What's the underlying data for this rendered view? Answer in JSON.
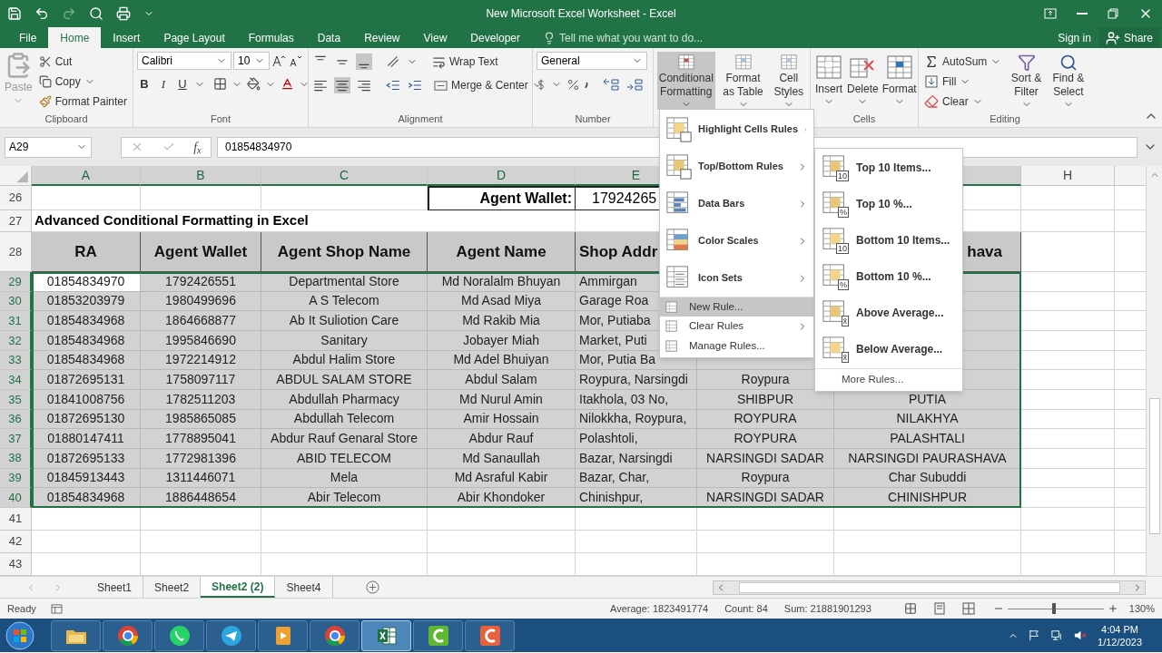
{
  "window": {
    "title": "New Microsoft Excel Worksheet - Excel"
  },
  "tabs": [
    {
      "label": "File",
      "selected": false
    },
    {
      "label": "Home",
      "selected": true
    },
    {
      "label": "Insert",
      "selected": false
    },
    {
      "label": "Page Layout",
      "selected": false
    },
    {
      "label": "Formulas",
      "selected": false
    },
    {
      "label": "Data",
      "selected": false
    },
    {
      "label": "Review",
      "selected": false
    },
    {
      "label": "View",
      "selected": false
    },
    {
      "label": "Developer",
      "selected": false
    }
  ],
  "tell_me": {
    "placeholder": "Tell me what you want to do..."
  },
  "account": {
    "sign_in": "Sign in",
    "share": "Share"
  },
  "ribbon": {
    "clipboard": {
      "label": "Clipboard",
      "paste": "Paste",
      "cut": "Cut",
      "copy": "Copy",
      "format_painter": "Format Painter"
    },
    "font": {
      "label": "Font",
      "name": "Calibri",
      "size": "10",
      "bold": "B",
      "italic": "I",
      "underline": "U"
    },
    "alignment": {
      "label": "Alignment",
      "wrap_text": "Wrap Text",
      "merge": "Merge & Center"
    },
    "number": {
      "label": "Number",
      "format": "General"
    },
    "styles": {
      "conditional_formatting": {
        "label": "Conditional Formatting",
        "expanded": true
      },
      "format_as_table": "Format as Table",
      "cell_styles": "Cell Styles"
    },
    "cells": {
      "label": "Cells",
      "insert": "Insert",
      "delete": "Delete",
      "format": "Format"
    },
    "editing": {
      "label": "Editing",
      "autosum": "AutoSum",
      "fill": "Fill",
      "clear": "Clear",
      "sort_filter": "Sort & Filter",
      "find_select": "Find & Select"
    }
  },
  "formula_bar": {
    "name_box": "A29",
    "function_label": "f$_{x}$",
    "value": "01854834970"
  },
  "grid": {
    "columns": [
      {
        "label": "A",
        "selected": true
      },
      {
        "label": "B",
        "selected": true
      },
      {
        "label": "C",
        "selected": true
      },
      {
        "label": "D",
        "selected": true
      },
      {
        "label": "E",
        "selected": true
      },
      null,
      {
        "selected": true
      },
      {
        "label": "H",
        "selected": false
      }
    ],
    "rows": [
      {
        "number": "26",
        "kind": "wallet",
        "selected": false,
        "cells": [
          null,
          null,
          null,
          "Agent Wallet:",
          "17924265"
        ]
      },
      {
        "number": "27",
        "kind": "title",
        "selected": false,
        "cells": [
          "Advanced Conditional Formatting in Excel"
        ]
      },
      {
        "number": "28",
        "kind": "header",
        "selected": false,
        "cells": [
          "RA",
          "Agent Wallet",
          "Agent Shop Name",
          "Agent Name",
          "Shop Addr",
          null,
          "hava"
        ]
      },
      {
        "number": "29",
        "kind": "data",
        "selected": true,
        "active": true,
        "cells": [
          "01854834970",
          "1792426551",
          "Departmental Store",
          "Md Noralalm Bhuyan",
          "Ammirgan",
          null,
          null
        ]
      },
      {
        "number": "30",
        "kind": "data",
        "selected": true,
        "active": false,
        "cells": [
          "01853203979",
          "1980499696",
          "A S Telecom",
          "Md Asad Miya",
          "Garage Roa",
          null,
          null
        ]
      },
      {
        "number": "31",
        "kind": "data",
        "selected": true,
        "active": false,
        "cells": [
          "01854834968",
          "1864668877",
          "Ab It Suliotion Care",
          "Md Rakib Mia",
          "Mor, Putiaba",
          null,
          null
        ]
      },
      {
        "number": "32",
        "kind": "data",
        "selected": true,
        "active": false,
        "cells": [
          "01854834968",
          "1995846690",
          "Sanitary",
          "Jobayer Miah",
          "Market, Puti",
          null,
          null
        ]
      },
      {
        "number": "33",
        "kind": "data",
        "selected": true,
        "active": false,
        "cells": [
          "01854834968",
          "1972214912",
          "Abdul Halim Store",
          "Md Adel Bhuiyan",
          "Mor, Putia Ba",
          null,
          null
        ]
      },
      {
        "number": "34",
        "kind": "data",
        "selected": true,
        "active": false,
        "cells": [
          "01872695131",
          "1758097117",
          "ABDUL SALAM STORE",
          "Abdul Salam",
          "Roypura, Narsingdi",
          "Roypura",
          null
        ]
      },
      {
        "number": "35",
        "kind": "data",
        "selected": true,
        "active": false,
        "cells": [
          "01841008756",
          "1782511203",
          "Abdullah Pharmacy",
          "Md Nurul Amin",
          "Itakhola, 03 No,",
          "SHIBPUR",
          "PUTIA"
        ]
      },
      {
        "number": "36",
        "kind": "data",
        "selected": true,
        "active": false,
        "cells": [
          "01872695130",
          "1985865085",
          "Abdullah Telecom",
          "Amir Hossain",
          "Nilokkha, Roypura,",
          "ROYPURA",
          "NILAKHYA"
        ]
      },
      {
        "number": "37",
        "kind": "data",
        "selected": true,
        "active": false,
        "cells": [
          "01880147411",
          "1778895041",
          "Abdur Rauf Genaral Store",
          "Abdur Rauf",
          "Polashtoli,",
          "ROYPURA",
          "PALASHTALI"
        ]
      },
      {
        "number": "38",
        "kind": "data",
        "selected": true,
        "active": false,
        "cells": [
          "01872695133",
          "1772981396",
          "ABID TELECOM",
          "Md Sanaullah",
          "Bazar, Narsingdi",
          "NARSINGDI SADAR",
          "NARSINGDI PAURASHAVA"
        ]
      },
      {
        "number": "39",
        "kind": "data",
        "selected": true,
        "active": false,
        "cells": [
          "01845913443",
          "1311446071",
          "Mela",
          "Md Asraful Kabir",
          "Bazar, Char,",
          "Roypura",
          "Char Subuddi"
        ]
      },
      {
        "number": "40",
        "kind": "data",
        "selected": true,
        "active": false,
        "cells": [
          "01854834968",
          "1886448654",
          "Abir Telecom",
          "Abir Khondoker",
          "Chinishpur,",
          "NARSINGDI SADAR",
          "CHINISHPUR"
        ]
      },
      {
        "number": "41",
        "kind": "empty",
        "selected": false
      },
      {
        "number": "42",
        "kind": "empty",
        "selected": false
      },
      {
        "number": "43",
        "kind": "empty",
        "selected": false
      }
    ]
  },
  "conditional_menu": {
    "items": [
      {
        "label": "Highlight Cells Rules",
        "kind": "large",
        "submenu": true,
        "selected": false
      },
      {
        "label": "Top/Bottom Rules",
        "kind": "large",
        "submenu": true,
        "selected": false
      },
      {
        "label": "Data Bars",
        "kind": "large",
        "submenu": true,
        "selected": false
      },
      {
        "label": "Color Scales",
        "kind": "large",
        "submenu": true,
        "selected": false
      },
      {
        "label": "Icon Sets",
        "kind": "large",
        "submenu": true,
        "selected": false
      },
      {
        "label": "New Rule...",
        "kind": "small",
        "submenu": false,
        "selected": true
      },
      {
        "label": "Clear Rules",
        "kind": "small",
        "submenu": true,
        "selected": false
      },
      {
        "label": "Manage Rules...",
        "kind": "small",
        "submenu": false,
        "selected": false
      }
    ],
    "submenu": {
      "items": [
        {
          "label": "Top 10 Items...",
          "badge": "10"
        },
        {
          "label": "Top 10 %...",
          "badge": "%"
        },
        {
          "label": "Bottom 10 Items...",
          "badge": "10"
        },
        {
          "label": "Bottom 10 %...",
          "badge": "%"
        },
        {
          "label": "Above Average...",
          "badge": "x̄"
        },
        {
          "label": "Below Average...",
          "badge": "x̄"
        }
      ],
      "more": "More Rules..."
    }
  },
  "sheets": [
    {
      "label": "Sheet1",
      "selected": false
    },
    {
      "label": "Sheet2",
      "selected": false
    },
    {
      "label": "Sheet2 (2)",
      "selected": true
    },
    {
      "label": "Sheet4",
      "selected": false
    }
  ],
  "status_bar": {
    "mode": "Ready",
    "average": "Average: 1823491774",
    "count": "Count: 84",
    "sum": "Sum: 21881901293",
    "zoom": "130%",
    "level": 0.46
  },
  "taskbar": {
    "apps": [
      {
        "kind": "explorer",
        "selected": false
      },
      {
        "kind": "chrome",
        "selected": false
      },
      {
        "kind": "whatsapp",
        "selected": false
      },
      {
        "kind": "telegram",
        "selected": false
      },
      {
        "kind": "player",
        "selected": false
      },
      {
        "kind": "chrome",
        "selected": false
      },
      {
        "kind": "excel",
        "selected": true
      },
      {
        "kind": "camtasia_green",
        "selected": false
      },
      {
        "kind": "camtasia_orange",
        "selected": false
      }
    ],
    "time": "4:04 PM",
    "date": "1/12/2023"
  }
}
